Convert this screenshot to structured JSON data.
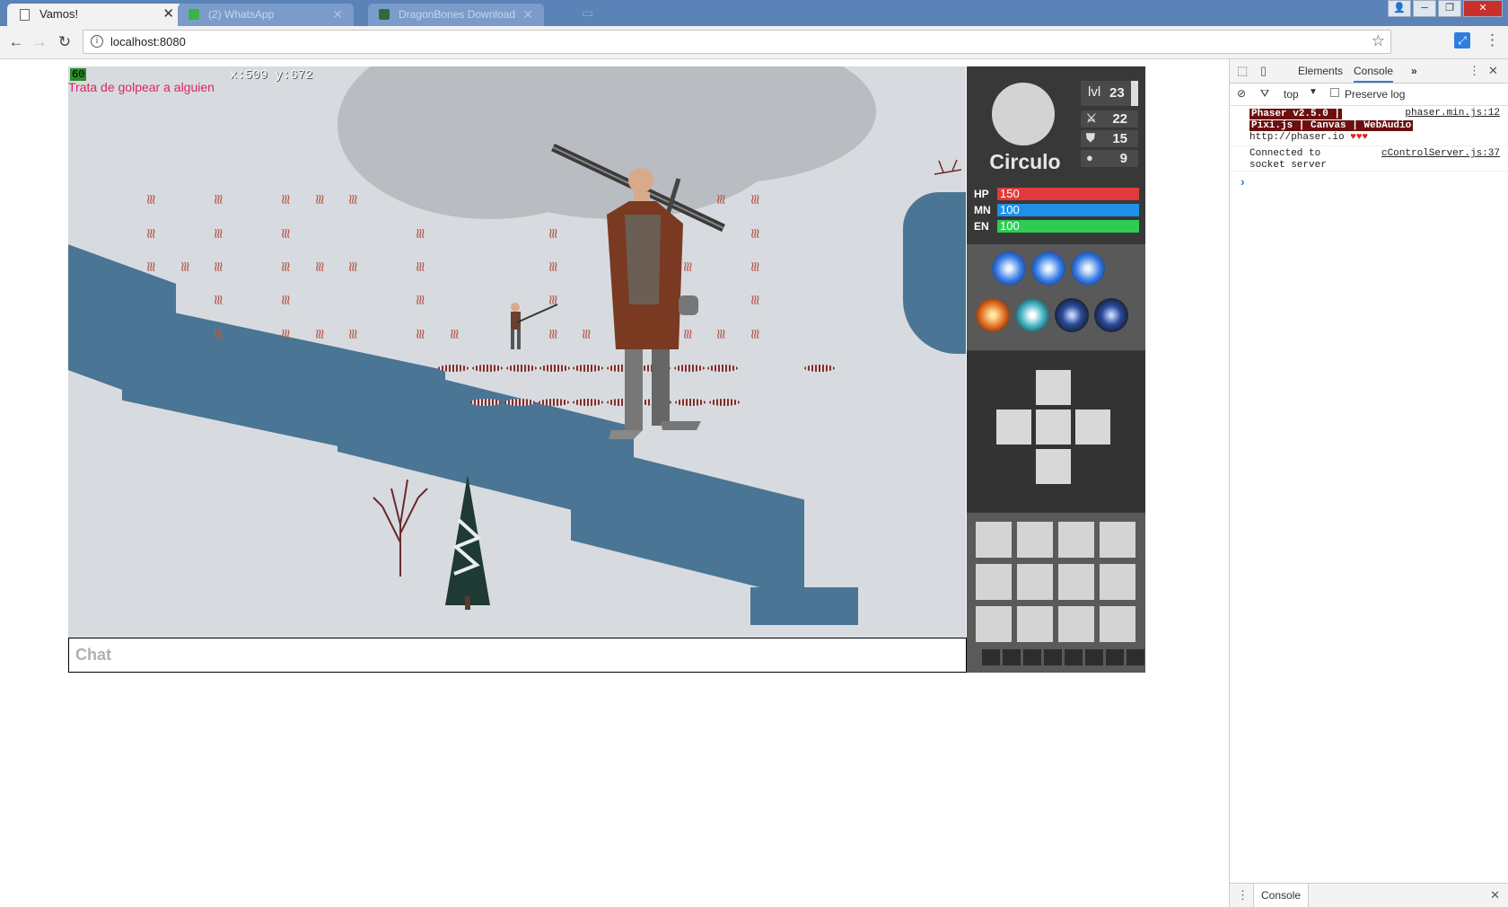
{
  "browser": {
    "tabs": [
      {
        "title": "Vamos!",
        "active": true
      },
      {
        "title": "(2) WhatsApp",
        "active": false
      },
      {
        "title": "DragonBones Download",
        "active": false
      }
    ],
    "url": "localhost:8080",
    "window_buttons": {
      "user": "👤",
      "minimize": "─",
      "restore": "❐",
      "close": "✕"
    }
  },
  "game": {
    "fps": "60",
    "hint": "Trata de golpear a alguien",
    "coords": "x:509 y:672",
    "chat_placeholder": "Chat"
  },
  "hud": {
    "player_name": "Circulo",
    "level_label": "lvl",
    "level": "23",
    "stats": [
      {
        "icon": "sword-icon",
        "glyph": "⚔",
        "value": "22"
      },
      {
        "icon": "shield-icon",
        "glyph": "⛊",
        "value": "15"
      },
      {
        "icon": "person-icon",
        "glyph": "●",
        "value": "9"
      }
    ],
    "bars": [
      {
        "label": "HP",
        "value": "150",
        "color": "#e03b3b"
      },
      {
        "label": "MN",
        "value": "100",
        "color": "#1e90e8"
      },
      {
        "label": "EN",
        "value": "100",
        "color": "#2fcc55"
      }
    ]
  },
  "devtools": {
    "tabs": [
      "Elements",
      "Console"
    ],
    "more": "»",
    "context": "top",
    "preserve_log": "Preserve log",
    "logs": [
      {
        "text_a": " Phaser v2.5.0 | ",
        "text_b": "Pixi.js | Canvas | WebAudio",
        "text_c": "http://phaser.io",
        "hearts": "♥♥♥",
        "source": "phaser.min.js:12"
      },
      {
        "text": "Connected to socket server",
        "source": "cControlServer.js:37"
      }
    ],
    "prompt": "›",
    "drawer_tab": "Console"
  }
}
